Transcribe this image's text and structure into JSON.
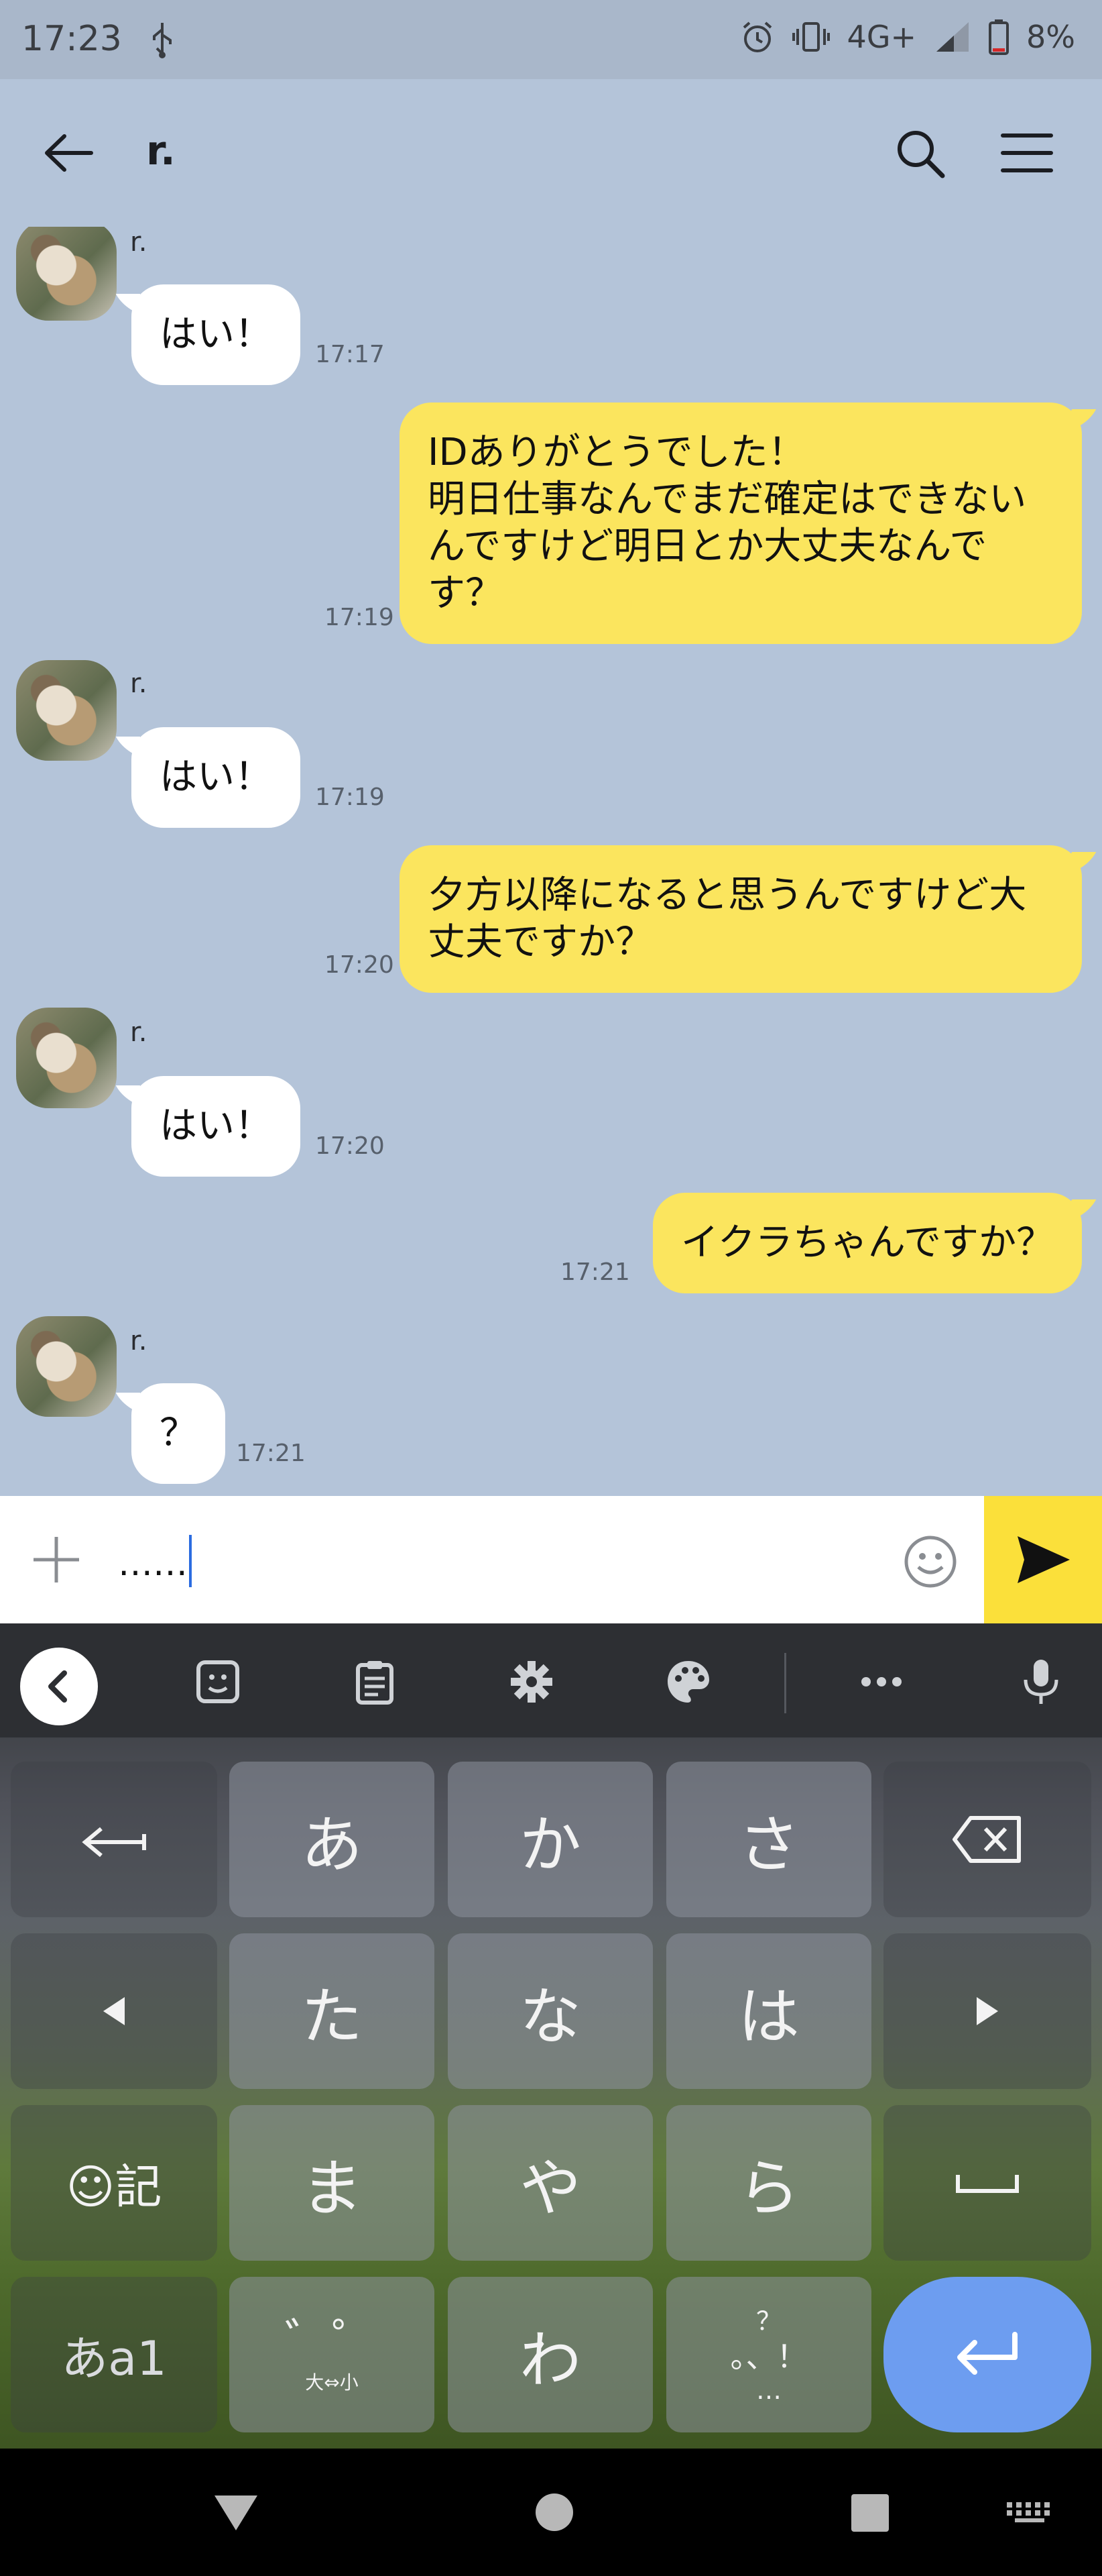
{
  "status_bar": {
    "time": "17:23",
    "network": "4G+",
    "battery": "8%"
  },
  "header": {
    "title": "r."
  },
  "messages": [
    {
      "dir": "in",
      "sender": "r.",
      "text": "はい！",
      "time": "17:17"
    },
    {
      "dir": "out",
      "text": "IDありがとうでした！\n明日仕事なんでまだ確定はできないんですけど明日とか大丈夫なんです？",
      "time": "17:19"
    },
    {
      "dir": "in",
      "sender": "r.",
      "text": "はい！",
      "time": "17:19"
    },
    {
      "dir": "out",
      "text": "夕方以降になると思うんですけど大丈夫ですか？",
      "time": "17:20"
    },
    {
      "dir": "in",
      "sender": "r.",
      "text": "はい！",
      "time": "17:20"
    },
    {
      "dir": "out",
      "text": "イクラちゃんですか？",
      "time": "17:21"
    },
    {
      "dir": "in",
      "sender": "r.",
      "text": "？",
      "time": "17:21"
    }
  ],
  "input": {
    "value": "……"
  },
  "keyboard": {
    "toolbar_icons": [
      "collapse-icon",
      "sticker-icon",
      "clipboard-icon",
      "settings-icon",
      "theme-icon",
      "more-icon",
      "microphone-icon"
    ],
    "keys": {
      "a": "あ",
      "ka": "か",
      "sa": "さ",
      "ta": "た",
      "na": "な",
      "ha": "は",
      "ma": "ま",
      "ya": "や",
      "ra": "ら",
      "wa": "わ",
      "emoji_symbol": "☺記",
      "mode": "あa1",
      "dakuten": "゛゜",
      "dakuten_sub": "大⇔小",
      "punct_top": "？",
      "punct_mid": "。、！",
      "punct_bottom": "…"
    },
    "accent_color": "#6d9df0"
  },
  "colors": {
    "chat_bg": "#b4c4d9",
    "out_bubble": "#fbe55e",
    "send_button": "#fbe03a"
  }
}
